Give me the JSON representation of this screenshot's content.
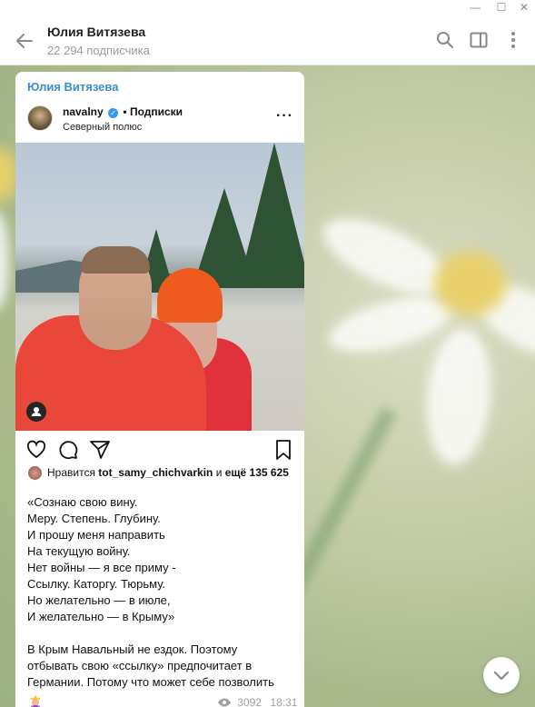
{
  "window": {
    "minimize_glyph": "—",
    "maximize_glyph": "☐",
    "close_glyph": "✕"
  },
  "header": {
    "title": "Юлия Витязева",
    "subtitle": "22 294 подписчика",
    "icons": [
      "back-arrow-icon",
      "search-icon",
      "sidebar-toggle-icon",
      "more-vertical-icon"
    ]
  },
  "message": {
    "sender": "Юлия Витязева",
    "instagram": {
      "username": "navalny",
      "separator": "•",
      "follow_label": "Подписки",
      "location": "Северный полюс",
      "more_glyph": "···",
      "likes_prefix": "Нравится",
      "likes_user": "tot_samy_chichvarkin",
      "likes_and": "и",
      "likes_rest": "ещё 135 625"
    },
    "caption_lines": [
      "«Сознаю свою вину.",
      "Меру. Степень. Глубину.",
      "И прошу меня направить",
      "На текущую войну.",
      "Нет войны — я все приму -",
      "Ссылку. Каторгу. Тюрьму.",
      "Но желательно — в июле,",
      "И желательно — в Крыму»"
    ],
    "body_lines": [
      "В Крым Навальный не ездок. Поэтому",
      "отбывать свою  «ссылку» предпочитает в",
      "Германии. Потому что может себе позволить"
    ],
    "views": "3092",
    "time": "18:31"
  },
  "colors": {
    "accent": "#3a8fc4",
    "chat_bg": "#b7c49b",
    "meta": "#a0a0a0"
  }
}
